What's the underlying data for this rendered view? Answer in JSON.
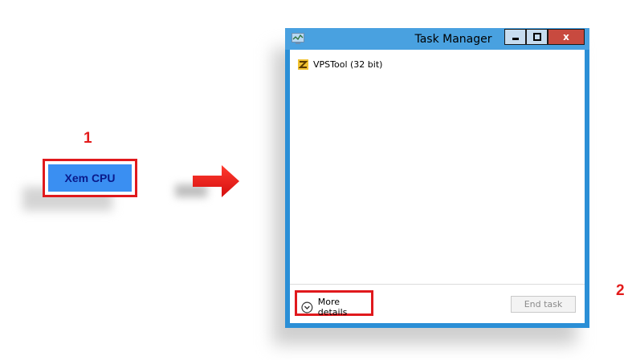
{
  "steps": {
    "step1": "1",
    "step2": "2"
  },
  "left_button": {
    "label": "Xem CPU"
  },
  "task_manager": {
    "title": "Task Manager",
    "close_label": "x",
    "processes": [
      {
        "name": "VPSTool (32 bit)",
        "icon": "vpstool-icon"
      }
    ],
    "more_details": "More details",
    "end_task": "End task"
  },
  "colors": {
    "accent_red": "#e0191d",
    "button_blue": "#3a8ff2",
    "window_frame": "#2b8fd6"
  }
}
